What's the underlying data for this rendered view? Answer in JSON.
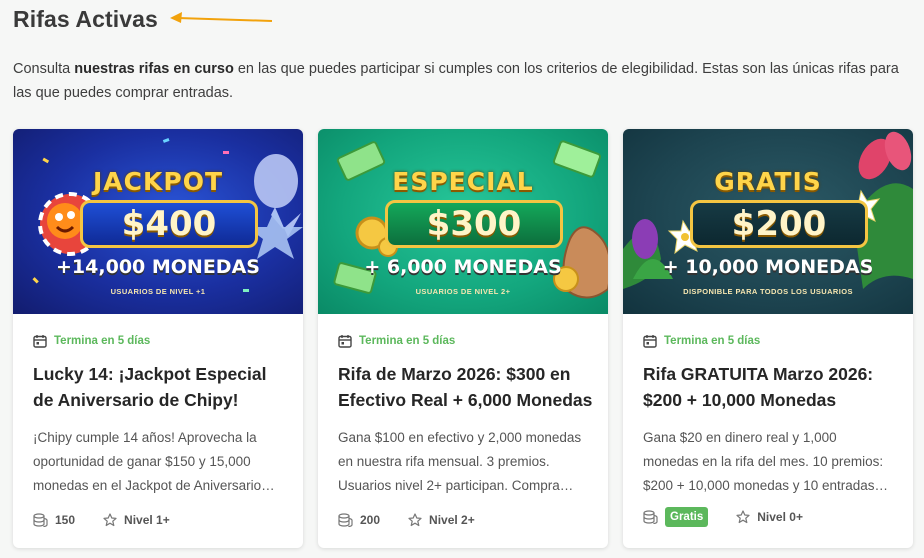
{
  "page": {
    "title": "Rifas Activas",
    "intro_pre": "Consulta ",
    "intro_bold": "nuestras rifas en curso",
    "intro_post": " en las que puedes participar si cumples con los criterios de elegibilidad. Estas son las únicas rifas para las que puedes comprar entradas."
  },
  "cards": [
    {
      "banner": {
        "head": "JACKPOT",
        "amount": "$400",
        "sub": "+14,000 MONEDAS",
        "foot": "USUARIOS DE NIVEL +1"
      },
      "ends": "Termina en 5 días",
      "title": "Lucky 14: ¡Jackpot Especial de Aniversario de Chipy!",
      "description": "¡Chipy cumple 14 años! Aprovecha la oportunidad de ganar $150 y 15,000 monedas en el Jackpot de Aniversario…",
      "entries": "150",
      "level": "Nivel 1+"
    },
    {
      "banner": {
        "head": "ESPECIAL",
        "amount": "$300",
        "sub": "+ 6,000 MONEDAS",
        "foot": "USUARIOS DE NIVEL 2+"
      },
      "ends": "Termina en 5 días",
      "title": "Rifa de Marzo 2026: $300 en Efectivo Real + 6,000 Monedas",
      "description": "Gana $100 en efectivo y 2,000 monedas en nuestra rifa mensual. 3 premios. Usuarios nivel 2+ participan. Compra…",
      "entries": "200",
      "level": "Nivel 2+"
    },
    {
      "banner": {
        "head": "GRATIS",
        "amount": "$200",
        "sub": "+ 10,000 MONEDAS",
        "foot": "DISPONIBLE PARA TODOS LOS USUARIOS"
      },
      "ends": "Termina en 5 días",
      "title": "Rifa GRATUITA Marzo 2026: $200 + 10,000 Monedas",
      "description": "Gana $20 en dinero real y 1,000 monedas en la rifa del mes. 10 premios: $200 + 10,000 monedas y 10 entradas…",
      "price_badge": "Gratis",
      "level": "Nivel 0+"
    }
  ],
  "colors": {
    "accent_green": "#5cb85c",
    "arrow": "#f2a20c",
    "gold": "#ffd54a"
  }
}
